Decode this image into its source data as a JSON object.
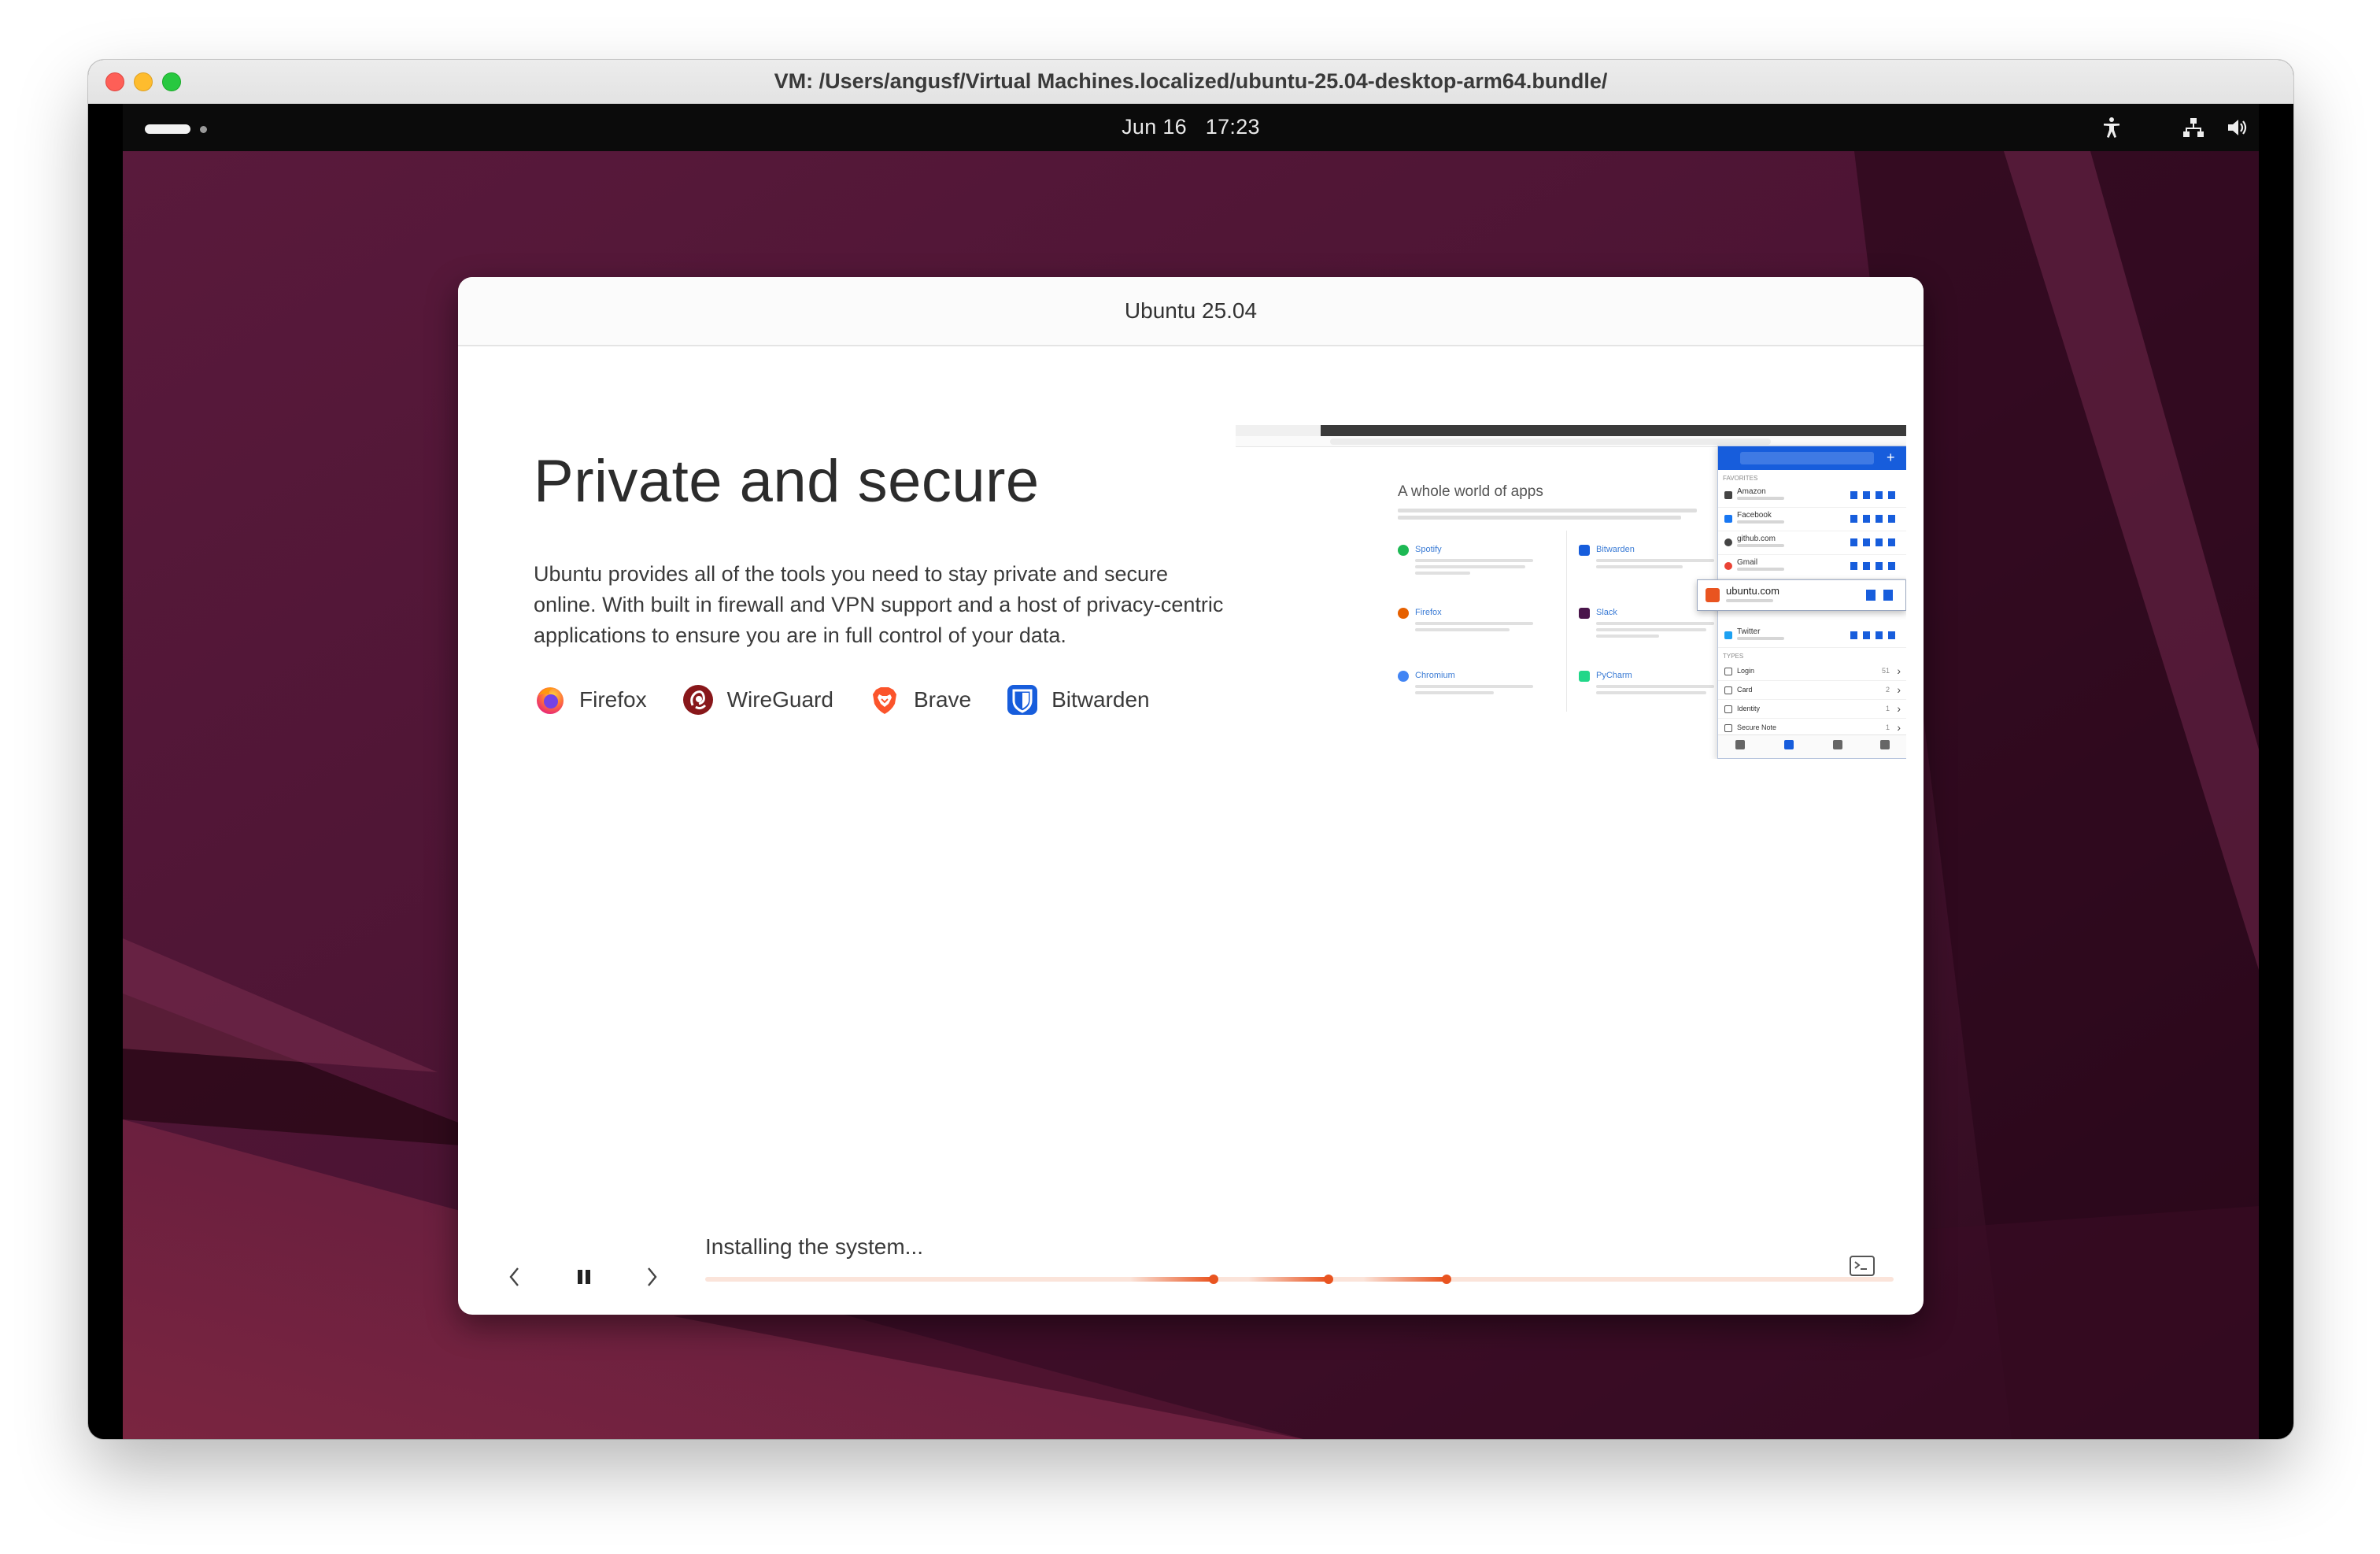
{
  "window": {
    "title": "VM: /Users/angusf/Virtual Machines.localized/ubuntu-25.04-desktop-arm64.bundle/"
  },
  "topbar": {
    "date": "Jun 16",
    "time": "17:23",
    "icons": [
      "accessibility-icon",
      "network-wired-icon",
      "volume-icon",
      "power-icon"
    ]
  },
  "dialog": {
    "title": "Ubuntu 25.04"
  },
  "slide": {
    "heading": "Private and secure",
    "body": "Ubuntu provides all of the tools you need to stay private and secure online. With built in firewall and VPN support and a host of privacy-centric applications to ensure you are in full control of your data.",
    "apps": [
      {
        "label": "Firefox",
        "icon": "firefox-icon"
      },
      {
        "label": "WireGuard",
        "icon": "wireguard-icon"
      },
      {
        "label": "Brave",
        "icon": "brave-icon"
      },
      {
        "label": "Bitwarden",
        "icon": "bitwarden-icon"
      }
    ],
    "preview": {
      "heading": "A whole world of apps",
      "apps": [
        {
          "name": "Spotify",
          "color": "#1db954"
        },
        {
          "name": "Bitwarden",
          "color": "#175ddc"
        },
        {
          "name": "Firefox",
          "color": "#e66000"
        },
        {
          "name": "Slack",
          "color": "#4a154b"
        },
        {
          "name": "Chromium",
          "color": "#4285f4"
        },
        {
          "name": "PyCharm",
          "color": "#21d789"
        }
      ],
      "vault": {
        "favorites_label": "FAVORITES",
        "items": [
          "Amazon",
          "Facebook",
          "github.com",
          "Gmail",
          "Twitter"
        ],
        "popup_item": "ubuntu.com",
        "types_label": "TYPES",
        "types": [
          {
            "label": "Login",
            "count": "51"
          },
          {
            "label": "Card",
            "count": "2"
          },
          {
            "label": "Identity",
            "count": "1"
          },
          {
            "label": "Secure Note",
            "count": "1"
          }
        ]
      }
    }
  },
  "footer": {
    "status": "Installing the system...",
    "progress_state": "indeterminate",
    "accent_color": "#e95420",
    "controls": [
      "previous-slide-button",
      "pause-slideshow-button",
      "next-slide-button",
      "show-terminal-button"
    ]
  }
}
